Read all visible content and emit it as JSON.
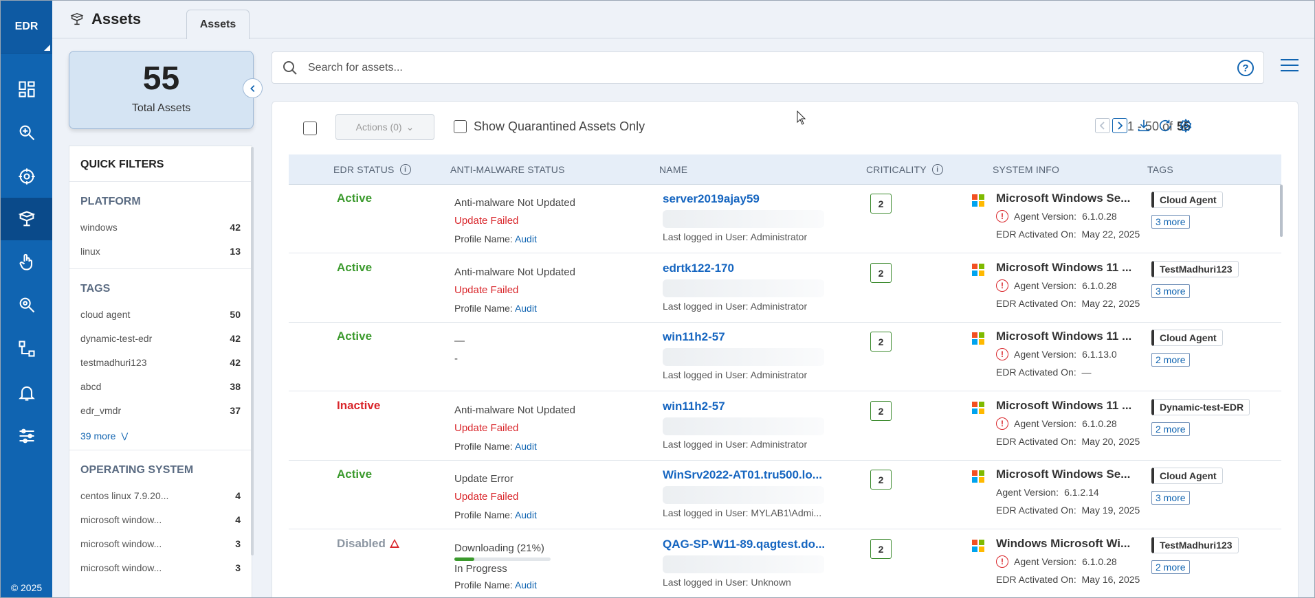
{
  "rail": {
    "brand": "EDR",
    "copyright": "© 2025",
    "items": [
      {
        "icon": "dashboard-icon"
      },
      {
        "icon": "investigate-icon"
      },
      {
        "icon": "threat-hunt-icon"
      },
      {
        "icon": "assets-icon",
        "active": true
      },
      {
        "icon": "response-icon"
      },
      {
        "icon": "detections-icon"
      },
      {
        "icon": "workflow-icon"
      },
      {
        "icon": "alerts-bell-icon"
      },
      {
        "icon": "settings-sliders-icon"
      }
    ]
  },
  "header": {
    "title": "Assets",
    "tab": "Assets"
  },
  "summary": {
    "count": "55",
    "label": "Total Assets"
  },
  "filters": {
    "heading": "QUICK FILTERS",
    "platform": {
      "title": "PLATFORM",
      "items": [
        {
          "label": "windows",
          "count": "42"
        },
        {
          "label": "linux",
          "count": "13"
        }
      ]
    },
    "tags": {
      "title": "TAGS",
      "items": [
        {
          "label": "cloud agent",
          "count": "50"
        },
        {
          "label": "dynamic-test-edr",
          "count": "42"
        },
        {
          "label": "testmadhuri123",
          "count": "42"
        },
        {
          "label": "abcd",
          "count": "38"
        },
        {
          "label": "edr_vmdr",
          "count": "37"
        }
      ],
      "more": "39 more"
    },
    "os": {
      "title": "OPERATING SYSTEM",
      "items": [
        {
          "label": "centos linux 7.9.20...",
          "count": "4"
        },
        {
          "label": "microsoft window...",
          "count": "4"
        },
        {
          "label": "microsoft window...",
          "count": "3"
        },
        {
          "label": "microsoft window...",
          "count": "3"
        }
      ]
    }
  },
  "search": {
    "placeholder": "Search for assets...",
    "value": ""
  },
  "toolbar": {
    "actions": "Actions (0)",
    "quarantine": "Show Quarantined Assets Only",
    "range": "1 - 50 of",
    "total": "55"
  },
  "columns": {
    "edr_status": "EDR STATUS",
    "antimalware": "ANTI-MALWARE STATUS",
    "name": "NAME",
    "criticality": "CRITICALITY",
    "system_info": "SYSTEM INFO",
    "tags": "TAGS"
  },
  "colors": {
    "brand": "#1064b1",
    "active": "#3b9a2d",
    "inactive": "#d9262b",
    "link": "#1565c0"
  },
  "rows": [
    {
      "status": "Active",
      "status_class": "active",
      "am_line1": "Anti-malware Not Updated",
      "am_line2": "Update Failed",
      "profile_label": "Profile Name:",
      "profile": "Audit",
      "name": "server2019ajay59",
      "last_user_label": "Last logged in User:",
      "last_user": "Administrator",
      "criticality": "2",
      "os": "Microsoft Windows Se...",
      "agent_label": "Agent Version:",
      "agent_version": "6.1.0.28",
      "agent_warn": true,
      "edr_label": "EDR Activated On:",
      "edr_on": "May 22, 2025",
      "tag": "Cloud Agent",
      "tag_more": "3 more"
    },
    {
      "status": "Active",
      "status_class": "active",
      "am_line1": "Anti-malware Not Updated",
      "am_line2": "Update Failed",
      "profile_label": "Profile Name:",
      "profile": "Audit",
      "name": "edrtk122-170",
      "last_user_label": "Last logged in User:",
      "last_user": "Administrator",
      "criticality": "2",
      "os": "Microsoft Windows 11 ...",
      "agent_label": "Agent Version:",
      "agent_version": "6.1.0.28",
      "agent_warn": true,
      "edr_label": "EDR Activated On:",
      "edr_on": "May 22, 2025",
      "tag": "TestMadhuri123",
      "tag_more": "3 more"
    },
    {
      "status": "Active",
      "status_class": "active",
      "am_line1": "—",
      "am_line2": "-",
      "profile_label": "",
      "profile": "",
      "name": "win11h2-57",
      "last_user_label": "Last logged in User:",
      "last_user": "Administrator",
      "criticality": "2",
      "os": "Microsoft Windows 11 ...",
      "agent_label": "Agent Version:",
      "agent_version": "6.1.13.0",
      "agent_warn": true,
      "edr_label": "EDR Activated On:",
      "edr_on": "—",
      "tag": "Cloud Agent",
      "tag_more": "2 more"
    },
    {
      "status": "Inactive",
      "status_class": "inactive",
      "am_line1": "Anti-malware Not Updated",
      "am_line2": "Update Failed",
      "profile_label": "Profile Name:",
      "profile": "Audit",
      "name": "win11h2-57",
      "last_user_label": "Last logged in User:",
      "last_user": "Administrator",
      "criticality": "2",
      "os": "Microsoft Windows 11 ...",
      "agent_label": "Agent Version:",
      "agent_version": "6.1.0.28",
      "agent_warn": true,
      "edr_label": "EDR Activated On:",
      "edr_on": "May 20, 2025",
      "tag": "Dynamic-test-EDR",
      "tag_more": "2 more"
    },
    {
      "status": "Active",
      "status_class": "active",
      "am_line1": "Update Error",
      "am_line2": "Update Failed",
      "profile_label": "Profile Name:",
      "profile": "Audit",
      "name": "WinSrv2022-AT01.tru500.lo...",
      "last_user_label": "Last logged in User:",
      "last_user": "MYLAB1\\Admi...",
      "criticality": "2",
      "os": "Microsoft Windows Se...",
      "agent_label": "Agent Version:",
      "agent_version": "6.1.2.14",
      "agent_warn": false,
      "edr_label": "EDR Activated On:",
      "edr_on": "May 19, 2025",
      "tag": "Cloud Agent",
      "tag_more": "3 more"
    },
    {
      "status": "Disabled",
      "status_class": "disabled",
      "am_line1": "Downloading (21%)",
      "am_progress": 0.21,
      "am_line2": "In Progress",
      "profile_label": "Profile Name:",
      "profile": "Audit",
      "name": "QAG-SP-W11-89.qagtest.do...",
      "last_user_label": "Last logged in User:",
      "last_user": "Unknown",
      "criticality": "2",
      "os": "Windows Microsoft Wi...",
      "agent_label": "Agent Version:",
      "agent_version": "6.1.0.28",
      "agent_warn": true,
      "edr_label": "EDR Activated On:",
      "edr_on": "May 16, 2025",
      "tag": "TestMadhuri123",
      "tag_more": "2 more"
    }
  ]
}
